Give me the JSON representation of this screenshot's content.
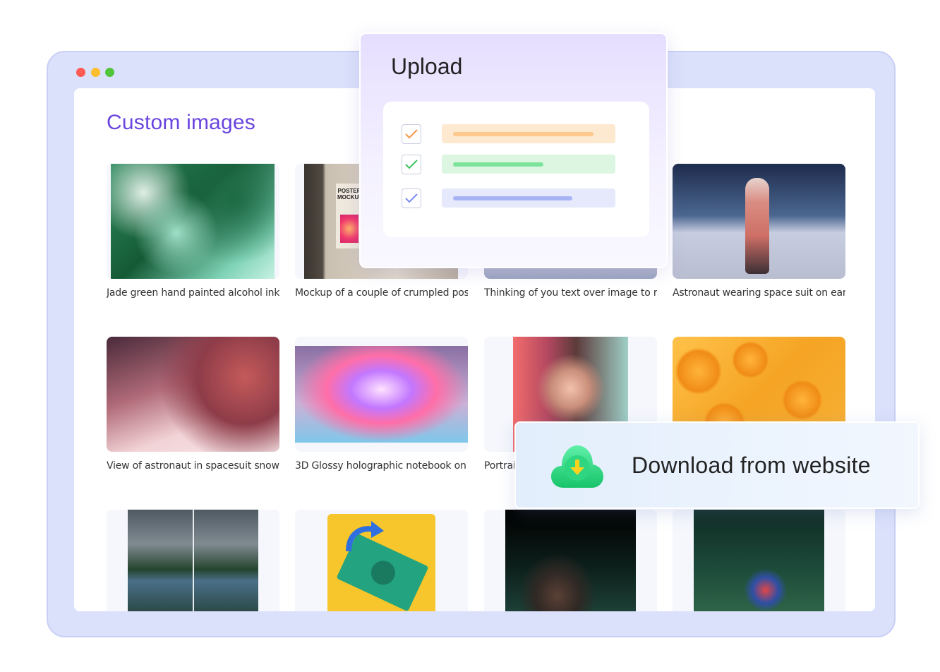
{
  "window": {
    "controls": [
      "close",
      "minimize",
      "maximize"
    ]
  },
  "main": {
    "title": "Custom images",
    "cards": [
      {
        "caption": "Jade green hand painted alcohol ink ...",
        "image": "green-alcohol-ink-art"
      },
      {
        "caption": "Mockup of a couple of crumpled pos...",
        "image": "poster-mockup-photo",
        "image_text": "POSTER MOCKUP"
      },
      {
        "caption": "Thinking of you text over image to re...",
        "image": "sky-landscape"
      },
      {
        "caption": "Astronaut wearing space suit on earth",
        "image": "astronaut-on-salt-flat"
      },
      {
        "caption": "View of astronaut in spacesuit snowb...",
        "image": "astronaut-snowboarding"
      },
      {
        "caption": "3D Glossy holographic notebook on ...",
        "image": "holographic-notebook"
      },
      {
        "caption": "Portrait",
        "image": "woman-portrait-neon"
      },
      {
        "caption": "",
        "image": "oranges-with-water-drops"
      },
      {
        "caption": "",
        "image": "mountain-lake-comparison"
      },
      {
        "caption": "",
        "image": "money-exchange-illustration"
      },
      {
        "caption": "",
        "image": "coffee-cup-dark"
      },
      {
        "caption": "",
        "image": "parrot-in-jungle"
      }
    ]
  },
  "upload_panel": {
    "title": "Upload",
    "rows": [
      {
        "check_color": "#f5994a",
        "bar_bg": "#fde8d0",
        "fill_color": "#fdc98c",
        "progress": 0.93
      },
      {
        "check_color": "#3cc45f",
        "bar_bg": "#dcf6e2",
        "fill_color": "#7ee39a",
        "progress": 0.6
      },
      {
        "check_color": "#7b8cf2",
        "bar_bg": "#e6e9fc",
        "fill_color": "#a8b3f6",
        "progress": 0.79
      }
    ]
  },
  "download_panel": {
    "label": "Download from website",
    "icon": "cloud-download-icon"
  },
  "colors": {
    "accent": "#6a45df",
    "window_frame": "#dbe1fb"
  }
}
